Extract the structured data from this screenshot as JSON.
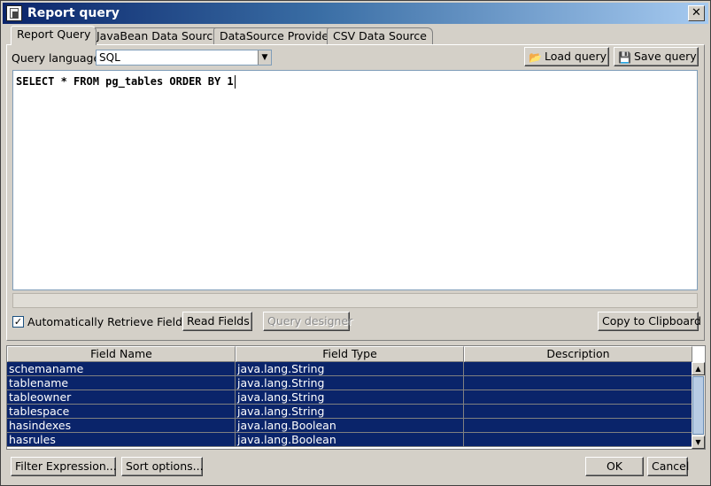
{
  "window": {
    "title": "Report query",
    "close_glyph": "✕"
  },
  "tabs": [
    {
      "label": "Report Query",
      "active": true
    },
    {
      "label": "JavaBean Data Source"
    },
    {
      "label": "DataSource Provider"
    },
    {
      "label": "CSV Data Source"
    }
  ],
  "query": {
    "language_label": "Query language",
    "language_value": "SQL",
    "load_label": "Load query",
    "save_label": "Save query",
    "sql_text": "SELECT * FROM pg_tables ORDER BY 1"
  },
  "options": {
    "auto_retrieve_label": "Automatically Retrieve Fields",
    "auto_retrieve_checked": true,
    "read_fields_label": "Read Fields",
    "query_designer_label": "Query designer",
    "copy_clipboard_label": "Copy to Clipboard"
  },
  "fields_table": {
    "headers": [
      "Field Name",
      "Field Type",
      "Description"
    ],
    "rows": [
      {
        "name": "schemaname",
        "type": "java.lang.String",
        "description": ""
      },
      {
        "name": "tablename",
        "type": "java.lang.String",
        "description": ""
      },
      {
        "name": "tableowner",
        "type": "java.lang.String",
        "description": ""
      },
      {
        "name": "tablespace",
        "type": "java.lang.String",
        "description": ""
      },
      {
        "name": "hasindexes",
        "type": "java.lang.Boolean",
        "description": ""
      },
      {
        "name": "hasrules",
        "type": "java.lang.Boolean",
        "description": ""
      }
    ],
    "selection_color": "#0a246a"
  },
  "footer": {
    "filter_label": "Filter Expression...",
    "sort_label": "Sort options...",
    "ok_label": "OK",
    "cancel_label": "Cancel"
  }
}
